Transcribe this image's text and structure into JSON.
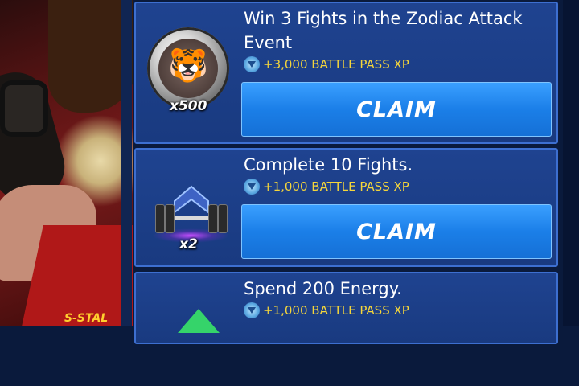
{
  "art": {
    "overlay_text": "S-STAL"
  },
  "tasks": [
    {
      "title": "Win 3 Fights in the Zodiac Attack Event",
      "xp": "+3,000 BATTLE PASS XP",
      "claim_label": "CLAIM",
      "reward_icon": "tiger-badge-icon",
      "reward_qty": "x500"
    },
    {
      "title": "Complete 10 Fights.",
      "xp": "+1,000 BATTLE PASS XP",
      "claim_label": "CLAIM",
      "reward_icon": "dumbbell-rank-icon",
      "reward_qty": "x2"
    },
    {
      "title": "Spend 200 Energy.",
      "xp": "+1,000 BATTLE PASS XP",
      "reward_icon": "green-gem-icon"
    }
  ],
  "colors": {
    "card_bg": "#1f4390",
    "card_border": "#3d6fd0",
    "claim_button": "#1b7fe8",
    "xp_text": "#f5d63b"
  }
}
